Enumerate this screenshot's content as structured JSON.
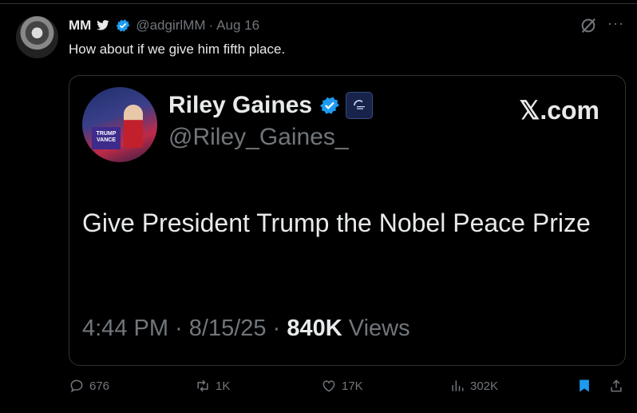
{
  "tweet": {
    "author_name": "MM",
    "author_handle": "@adgirlMM",
    "separator": "·",
    "date": "Aug 16",
    "text": "How about if we give him fifth place."
  },
  "quoted": {
    "name": "Riley Gaines",
    "handle": "@Riley_Gaines_",
    "source": "𝕏.com",
    "podium_text": "TRUMP VANCE",
    "text": "Give President Trump the Nobel Peace Prize",
    "time": "4:44 PM",
    "date": "8/15/25",
    "separator": "·",
    "views_count": "840K",
    "views_label": "Views"
  },
  "actions": {
    "replies": "676",
    "reposts": "1K",
    "likes": "17K",
    "views": "302K"
  },
  "colors": {
    "background": "#000000",
    "text": "#e7e9ea",
    "muted": "#71767b",
    "verified": "#1d9bf0",
    "bookmark": "#1d9bf0"
  },
  "icons": [
    "bird-icon",
    "verified-badge-icon",
    "grok-icon",
    "more-icon",
    "affiliate-badge-icon",
    "reply-icon",
    "repost-icon",
    "like-icon",
    "views-icon",
    "bookmark-icon",
    "share-icon"
  ]
}
